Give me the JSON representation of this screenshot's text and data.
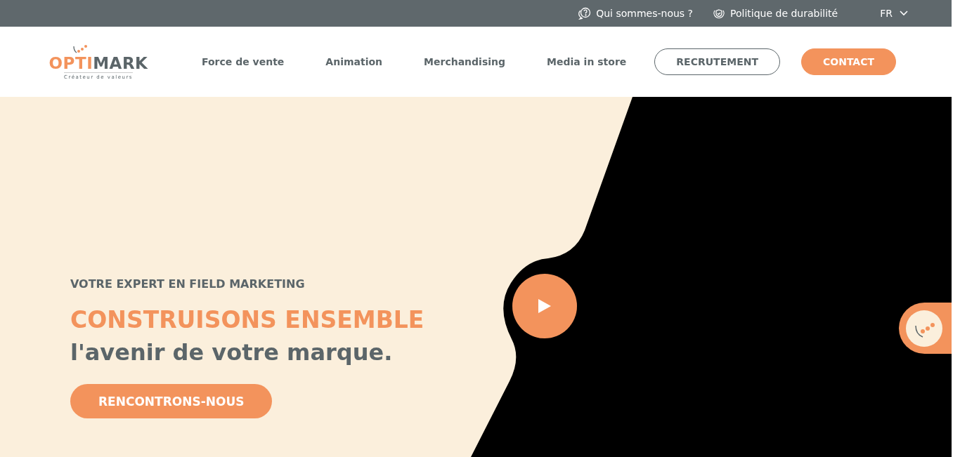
{
  "top_bar": {
    "links": [
      {
        "label": "Qui sommes-nous ?"
      },
      {
        "label": "Politique de durabilité"
      }
    ],
    "language": "FR"
  },
  "header": {
    "logo": {
      "primary": "OPTI",
      "secondary": "MARK",
      "tagline": "Créateur de valeurs"
    },
    "nav": [
      "Force de vente",
      "Animation",
      "Merchandising",
      "Media in store"
    ],
    "buttons": [
      {
        "label": "RECRUTEMENT",
        "kind": "outline"
      },
      {
        "label": "CONTACT",
        "kind": "filled"
      }
    ]
  },
  "hero": {
    "eyebrow": "VOTRE EXPERT EN FIELD MARKETING",
    "title": "CONSTRUISONS ENSEMBLE",
    "subtitle": "l'avenir de votre marque.",
    "cta": "RENCONTRONS-NOUS"
  }
}
